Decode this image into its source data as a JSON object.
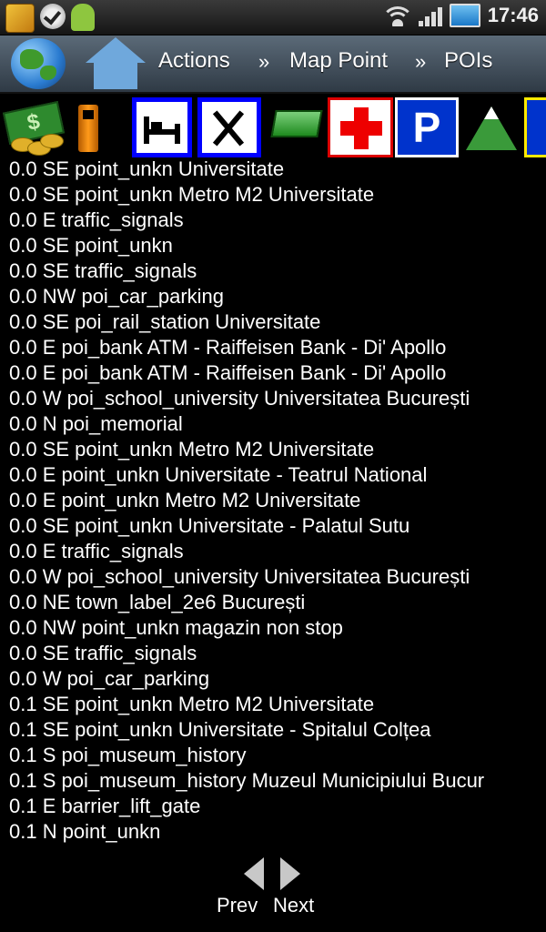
{
  "status_bar": {
    "time": "17:46",
    "icons": [
      "bird-app-icon",
      "check-icon",
      "android-icon",
      "wifi-icon",
      "signal-icon",
      "battery-icon"
    ]
  },
  "action_bar": {
    "crumbs": [
      {
        "label": "Actions"
      },
      {
        "label": "Map Point"
      },
      {
        "label": "POIs"
      }
    ],
    "separator": "»"
  },
  "poi_categories": [
    {
      "name": "money-icon",
      "symbol": "$"
    },
    {
      "name": "fuel-icon"
    },
    {
      "name": "hotel-bed-icon"
    },
    {
      "name": "restaurant-icon"
    },
    {
      "name": "shopping-cart-icon"
    },
    {
      "name": "hospital-icon"
    },
    {
      "name": "parking-icon",
      "symbol": "P"
    },
    {
      "name": "mountain-icon"
    },
    {
      "name": "info-icon"
    }
  ],
  "poi_list": [
    "0.0 SE point_unkn Universitate",
    "0.0 SE point_unkn Metro M2 Universitate",
    "0.0 E traffic_signals",
    "0.0 SE point_unkn",
    "0.0 SE traffic_signals",
    "0.0 NW poi_car_parking",
    "0.0 SE poi_rail_station Universitate",
    "0.0 E poi_bank ATM - Raiffeisen Bank - Di' Apollo",
    "0.0 E poi_bank ATM - Raiffeisen Bank - Di' Apollo",
    "0.0 W poi_school_university Universitatea București",
    "0.0 N poi_memorial",
    "0.0 SE point_unkn Metro M2 Universitate",
    "0.0 E point_unkn Universitate - Teatrul National",
    "0.0 E point_unkn Metro M2 Universitate",
    "0.0 SE point_unkn Universitate - Palatul Sutu",
    "0.0 E traffic_signals",
    "0.0 W poi_school_university Universitatea București",
    "0.0 NE town_label_2e6 București",
    "0.0 NW point_unkn magazin non stop",
    "0.0 SE traffic_signals",
    "0.0 W poi_car_parking",
    "0.1 SE point_unkn Metro M2 Universitate",
    "0.1 SE point_unkn Universitate - Spitalul Colțea",
    "0.1 S poi_museum_history",
    "0.1 S poi_museum_history Muzeul Municipiului Bucur",
    "0.1 E barrier_lift_gate",
    "0.1 N point_unkn"
  ],
  "pager": {
    "prev_label": "Prev",
    "next_label": "Next"
  }
}
